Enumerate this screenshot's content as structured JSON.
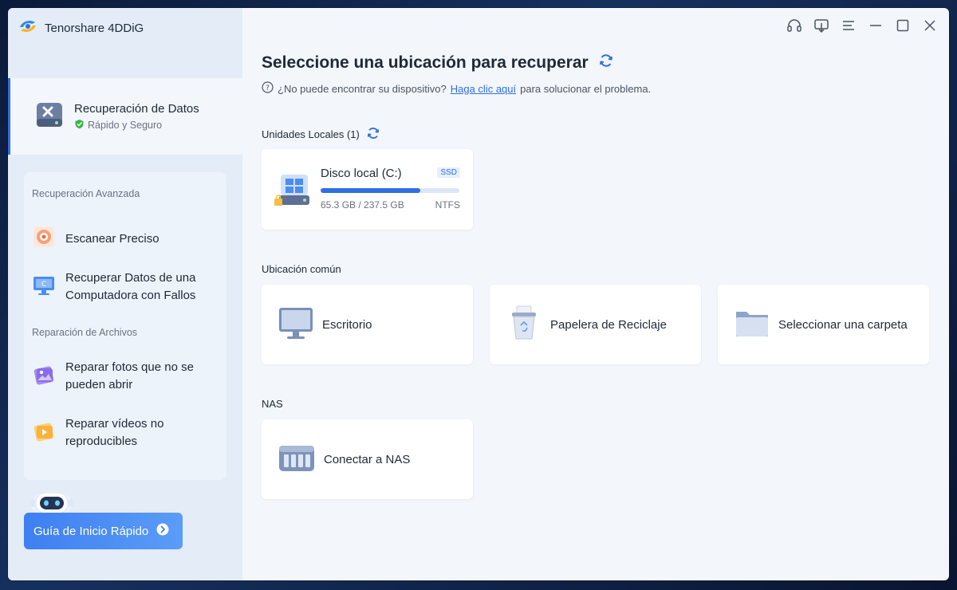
{
  "app": {
    "title": "Tenorshare 4DDiG"
  },
  "sidebar": {
    "main_item": {
      "title": "Recuperación de Datos",
      "subtitle": "Rápido y Seguro"
    },
    "advanced": {
      "label": "Recuperación Avanzada",
      "items": [
        {
          "label": "Escanear Preciso",
          "icon": "target-scan-icon"
        },
        {
          "label": "Recuperar Datos de una Computadora con Fallos",
          "icon": "crashed-computer-icon"
        }
      ]
    },
    "repair": {
      "label": "Reparación de Archivos",
      "items": [
        {
          "label": "Reparar fotos que no se pueden abrir",
          "icon": "photo-repair-icon"
        },
        {
          "label": "Reparar vídeos no reproducibles",
          "icon": "video-repair-icon"
        }
      ]
    },
    "quick_guide": {
      "label": "Guía de Inicio Rápido"
    }
  },
  "titlebar": {
    "icons": [
      "headset-icon",
      "download-icon",
      "menu-icon",
      "minimize-icon",
      "maximize-icon",
      "close-icon"
    ]
  },
  "main": {
    "title": "Seleccione una ubicación para recuperar",
    "help": {
      "prefix": "¿No puede encontrar su dispositivo?",
      "link": "Haga clic aquí",
      "suffix": "para solucionar el problema."
    },
    "local_drives": {
      "label": "Unidades Locales (1)",
      "drives": [
        {
          "name": "Disco local (C:)",
          "badge": "SSD",
          "size": "65.3 GB / 237.5 GB",
          "fs": "NTFS",
          "used_fraction": 0.72
        }
      ]
    },
    "common": {
      "label": "Ubicación común",
      "items": [
        {
          "label": "Escritorio",
          "icon": "desktop-icon"
        },
        {
          "label": "Papelera de Reciclaje",
          "icon": "recycle-bin-icon"
        },
        {
          "label": "Seleccionar una carpeta",
          "icon": "folder-icon"
        }
      ]
    },
    "nas": {
      "label": "NAS",
      "items": [
        {
          "label": "Conectar a NAS",
          "icon": "nas-icon"
        }
      ]
    }
  },
  "colors": {
    "accent": "#2f6fe4",
    "sidebar_bg": "#e3ecf7",
    "content_bg": "#f3f6fb"
  }
}
